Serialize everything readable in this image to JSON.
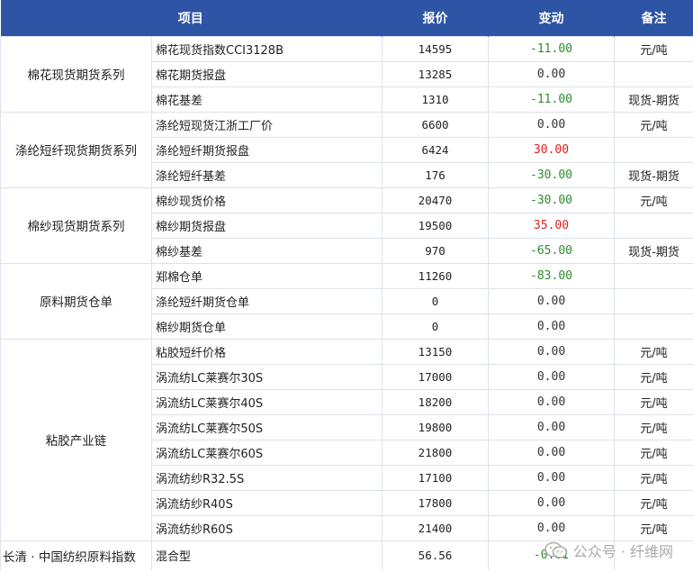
{
  "header": {
    "item": "项目",
    "price": "报价",
    "change": "变动",
    "note": "备注"
  },
  "groups": [
    {
      "name": "棉花现货期货系列",
      "rows": [
        {
          "item": "棉花现货指数CCI3128B",
          "price": "14595",
          "change": "-11.00",
          "note": "元/吨"
        },
        {
          "item": "棉花期货报盘",
          "price": "13285",
          "change": "0.00",
          "note": ""
        },
        {
          "item": "棉花基差",
          "price": "1310",
          "change": "-11.00",
          "note": "现货-期货"
        }
      ]
    },
    {
      "name": "涤纶短纤现货期货系列",
      "rows": [
        {
          "item": "涤纶短现货江浙工厂价",
          "price": "6600",
          "change": "0.00",
          "note": "元/吨"
        },
        {
          "item": "涤纶短纤期货报盘",
          "price": "6424",
          "change": "30.00",
          "note": ""
        },
        {
          "item": "涤纶短纤基差",
          "price": "176",
          "change": "-30.00",
          "note": "现货-期货"
        }
      ]
    },
    {
      "name": "棉纱现货期货系列",
      "rows": [
        {
          "item": "棉纱现货价格",
          "price": "20470",
          "change": "-30.00",
          "note": "元/吨"
        },
        {
          "item": "棉纱期货报盘",
          "price": "19500",
          "change": "35.00",
          "note": ""
        },
        {
          "item": "棉纱基差",
          "price": "970",
          "change": "-65.00",
          "note": "现货-期货"
        }
      ]
    },
    {
      "name": "原料期货仓单",
      "rows": [
        {
          "item": "郑棉仓单",
          "price": "11260",
          "change": "-83.00",
          "note": ""
        },
        {
          "item": "涤纶短纤期货仓单",
          "price": "0",
          "change": "0.00",
          "note": ""
        },
        {
          "item": "棉纱期货仓单",
          "price": "0",
          "change": "0.00",
          "note": ""
        }
      ]
    },
    {
      "name": "粘胶产业链",
      "rows": [
        {
          "item": "粘胶短纤价格",
          "price": "13150",
          "change": "0.00",
          "note": "元/吨"
        },
        {
          "item": "涡流纺LC莱赛尔30S",
          "price": "17000",
          "change": "0.00",
          "note": "元/吨"
        },
        {
          "item": "涡流纺LC莱赛尔40S",
          "price": "18200",
          "change": "0.00",
          "note": "元/吨"
        },
        {
          "item": "涡流纺LC莱赛尔50S",
          "price": "19800",
          "change": "0.00",
          "note": "元/吨"
        },
        {
          "item": "涡流纺LC莱赛尔60S",
          "price": "21800",
          "change": "0.00",
          "note": "元/吨"
        },
        {
          "item": "涡流纺纱R32.5S",
          "price": "17100",
          "change": "0.00",
          "note": "元/吨"
        },
        {
          "item": "涡流纺纱R40S",
          "price": "17800",
          "change": "0.00",
          "note": "元/吨"
        },
        {
          "item": "涡流纺纱R60S",
          "price": "21400",
          "change": "0.00",
          "note": "元/吨"
        }
      ]
    }
  ],
  "footer": {
    "group": "长清 · 中国纺织原料指数",
    "item": "混合型",
    "price": "56.56",
    "change": "-0.01",
    "note": ""
  },
  "watermark": {
    "text": "公众号 · 纤维网",
    "icon": "wechat-icon"
  },
  "colors": {
    "header_bg": "#2e55a5",
    "negative": "#2e8b2e",
    "positive": "#e02020"
  }
}
